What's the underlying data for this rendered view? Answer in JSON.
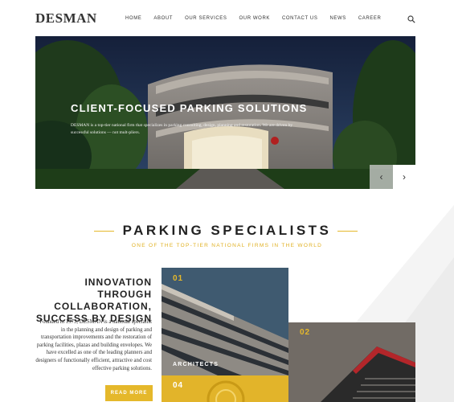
{
  "brand": {
    "logo": "DESMAN",
    "accent": "#e5b82b"
  },
  "nav": {
    "items": [
      {
        "label": "HOME"
      },
      {
        "label": "ABOUT"
      },
      {
        "label": "OUR SERVICES"
      },
      {
        "label": "OUR WORK"
      },
      {
        "label": "CONTACT US"
      },
      {
        "label": "NEWS"
      },
      {
        "label": "CAREER"
      }
    ],
    "search_icon": "search-icon"
  },
  "hero": {
    "title": "CLIENT-FOCUSED PARKING SOLUTIONS",
    "subtitle": "DESMAN is a top-tier national firm that specializes in parking consulting, design, planning and restoration. We are driven by successful solutions — not mult-pliers.",
    "prev_icon": "chevron-left-icon",
    "next_icon": "chevron-right-icon"
  },
  "section": {
    "title": "PARKING SPECIALISTS",
    "subtitle": "ONE OF THE TOP-TIER NATIONAL FIRMS IN THE WORLD"
  },
  "intro": {
    "heading": "INNOVATION THROUGH COLLABORATION, SUCCESS BY DESIGN",
    "body": "Founded in 1973, DESMAN is a national specialist in the planning and design of parking and transportation improvements and the restoration of parking facilities, plazas and building envelopes. We have excelled as one of the leading planners and designers of functionally efficient, attractive and cost effective parking solutions.",
    "button": "READ MORE"
  },
  "cards": [
    {
      "num": "01",
      "label": "ARCHITECTS"
    },
    {
      "num": "02"
    },
    {
      "num": "04"
    }
  ]
}
